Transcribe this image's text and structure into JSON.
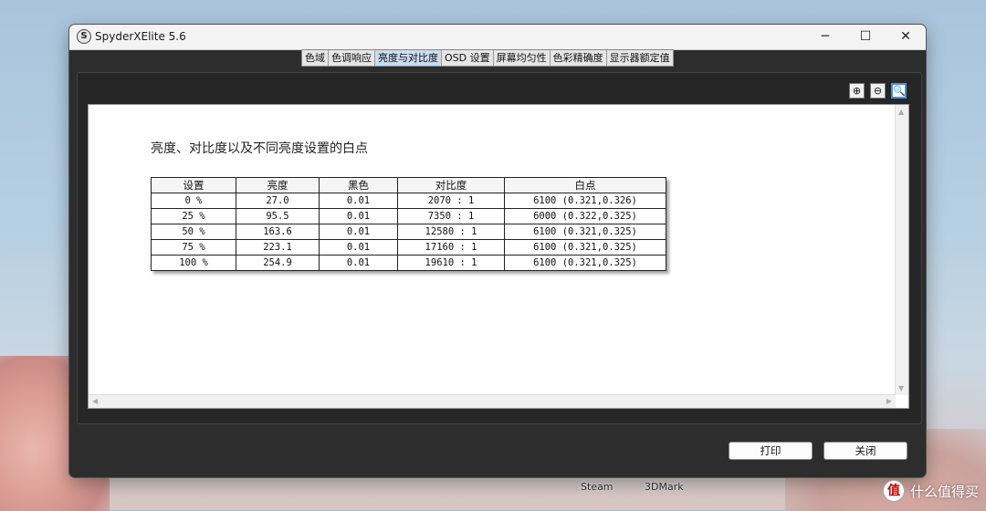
{
  "window": {
    "title": "SpyderXElite 5.6",
    "icon_letter": "S",
    "controls": {
      "minimize": "─",
      "maximize": "☐",
      "close": "✕"
    }
  },
  "tabs": [
    {
      "label": "色域"
    },
    {
      "label": "色调响应"
    },
    {
      "label": "亮度与对比度",
      "active": true
    },
    {
      "label": "OSD 设置"
    },
    {
      "label": "屏幕均匀性"
    },
    {
      "label": "色彩精确度"
    },
    {
      "label": "显示器额定值"
    }
  ],
  "zoom_tools": [
    {
      "icon": "zoom-in-icon",
      "glyph": "⊕"
    },
    {
      "icon": "zoom-out-icon",
      "glyph": "⊖"
    },
    {
      "icon": "zoom-fit-icon",
      "glyph": "🔍"
    }
  ],
  "report": {
    "title": "亮度、对比度以及不同亮度设置的白点",
    "table": {
      "headers": [
        "设置",
        "亮度",
        "黑色",
        "对比度",
        "白点"
      ],
      "rows": [
        [
          "0 %",
          "27.0",
          "0.01",
          "2070 : 1",
          "6100 (0.321,0.326)"
        ],
        [
          "25 %",
          "95.5",
          "0.01",
          "7350 : 1",
          "6000 (0.322,0.325)"
        ],
        [
          "50 %",
          "163.6",
          "0.01",
          "12580 : 1",
          "6100 (0.321,0.325)"
        ],
        [
          "75 %",
          "223.1",
          "0.01",
          "17160 : 1",
          "6100 (0.321,0.325)"
        ],
        [
          "100 %",
          "254.9",
          "0.01",
          "19610 : 1",
          "6100 (0.321,0.325)"
        ]
      ]
    }
  },
  "buttons": {
    "print": "打印",
    "close": "关闭"
  },
  "taskbar": {
    "item1": "Steam",
    "item2": "3DMark"
  },
  "watermark": {
    "logo": "值",
    "text": "什么值得买"
  }
}
